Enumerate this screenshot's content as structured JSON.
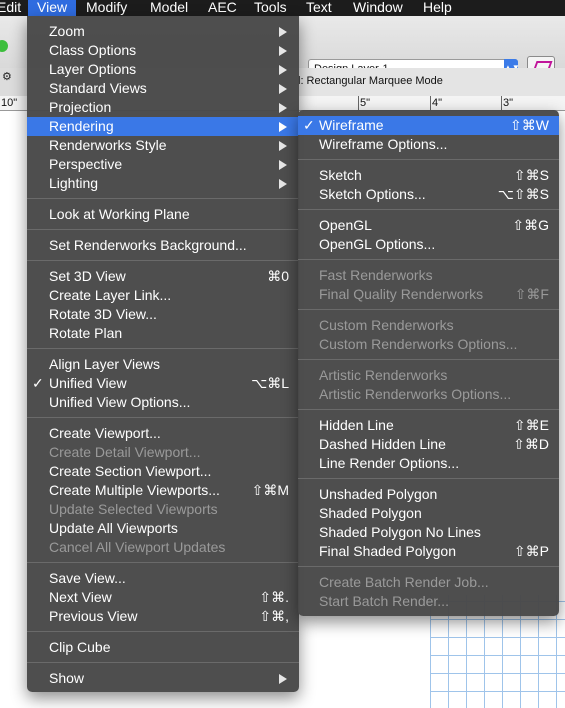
{
  "menubar": {
    "items": [
      {
        "label": "Edit",
        "active": false
      },
      {
        "label": "View",
        "active": true
      },
      {
        "label": "Modify",
        "active": false
      },
      {
        "label": "Model",
        "active": false
      },
      {
        "label": "AEC",
        "active": false
      },
      {
        "label": "Tools",
        "active": false
      },
      {
        "label": "Text",
        "active": false
      },
      {
        "label": "Window",
        "active": false
      },
      {
        "label": "Help",
        "active": false
      }
    ]
  },
  "toolbar": {
    "layer_select": "Design Layer-1",
    "mode_text": "l: Rectangular Marquee Mode"
  },
  "ruler": {
    "ticks": [
      "10\"",
      "5\"",
      "4\"",
      "3\""
    ]
  },
  "view_menu": {
    "items": [
      {
        "label": "Zoom",
        "submenu": true
      },
      {
        "label": "Class Options",
        "submenu": true
      },
      {
        "label": "Layer Options",
        "submenu": true
      },
      {
        "label": "Standard Views",
        "submenu": true
      },
      {
        "label": "Projection",
        "submenu": true
      },
      {
        "label": "Rendering",
        "submenu": true,
        "highlighted": true
      },
      {
        "label": "Renderworks Style",
        "submenu": true
      },
      {
        "label": "Perspective",
        "submenu": true
      },
      {
        "label": "Lighting",
        "submenu": true
      },
      {
        "separator": true
      },
      {
        "label": "Look at Working Plane"
      },
      {
        "separator": true
      },
      {
        "label": "Set Renderworks Background..."
      },
      {
        "separator": true
      },
      {
        "label": "Set 3D View",
        "shortcut": "⌘0"
      },
      {
        "label": "Create Layer Link..."
      },
      {
        "label": "Rotate 3D View..."
      },
      {
        "label": "Rotate Plan"
      },
      {
        "separator": true
      },
      {
        "label": "Align Layer Views"
      },
      {
        "label": "Unified View",
        "shortcut": "⌥⌘L",
        "checked": true
      },
      {
        "label": "Unified View Options..."
      },
      {
        "separator": true
      },
      {
        "label": "Create Viewport..."
      },
      {
        "label": "Create Detail Viewport...",
        "disabled": true
      },
      {
        "label": "Create Section Viewport..."
      },
      {
        "label": "Create Multiple Viewports...",
        "shortcut": "⇧⌘M"
      },
      {
        "label": "Update Selected Viewports",
        "disabled": true
      },
      {
        "label": "Update All Viewports"
      },
      {
        "label": "Cancel All Viewport Updates",
        "disabled": true
      },
      {
        "separator": true
      },
      {
        "label": "Save View..."
      },
      {
        "label": "Next View",
        "shortcut": "⇧⌘."
      },
      {
        "label": "Previous View",
        "shortcut": "⇧⌘,"
      },
      {
        "separator": true
      },
      {
        "label": "Clip Cube"
      },
      {
        "separator": true
      },
      {
        "label": "Show",
        "submenu": true
      }
    ]
  },
  "rendering_submenu": {
    "items": [
      {
        "label": "Wireframe",
        "shortcut": "⇧⌘W",
        "checked": true,
        "highlighted": true
      },
      {
        "label": "Wireframe Options..."
      },
      {
        "separator": true
      },
      {
        "label": "Sketch",
        "shortcut": "⇧⌘S"
      },
      {
        "label": "Sketch Options...",
        "shortcut": "⌥⇧⌘S"
      },
      {
        "separator": true
      },
      {
        "label": "OpenGL",
        "shortcut": "⇧⌘G"
      },
      {
        "label": "OpenGL Options..."
      },
      {
        "separator": true
      },
      {
        "label": "Fast Renderworks",
        "disabled": true
      },
      {
        "label": "Final Quality Renderworks",
        "shortcut": "⇧⌘F",
        "disabled": true
      },
      {
        "separator": true
      },
      {
        "label": "Custom Renderworks",
        "disabled": true
      },
      {
        "label": "Custom Renderworks Options...",
        "disabled": true
      },
      {
        "separator": true
      },
      {
        "label": "Artistic Renderworks",
        "disabled": true
      },
      {
        "label": "Artistic Renderworks Options...",
        "disabled": true
      },
      {
        "separator": true
      },
      {
        "label": "Hidden Line",
        "shortcut": "⇧⌘E"
      },
      {
        "label": "Dashed Hidden Line",
        "shortcut": "⇧⌘D"
      },
      {
        "label": "Line Render Options..."
      },
      {
        "separator": true
      },
      {
        "label": "Unshaded Polygon"
      },
      {
        "label": "Shaded Polygon"
      },
      {
        "label": "Shaded Polygon No Lines"
      },
      {
        "label": "Final Shaded Polygon",
        "shortcut": "⇧⌘P"
      },
      {
        "separator": true
      },
      {
        "label": "Create Batch Render Job...",
        "disabled": true
      },
      {
        "label": "Start Batch Render...",
        "disabled": true
      }
    ]
  }
}
